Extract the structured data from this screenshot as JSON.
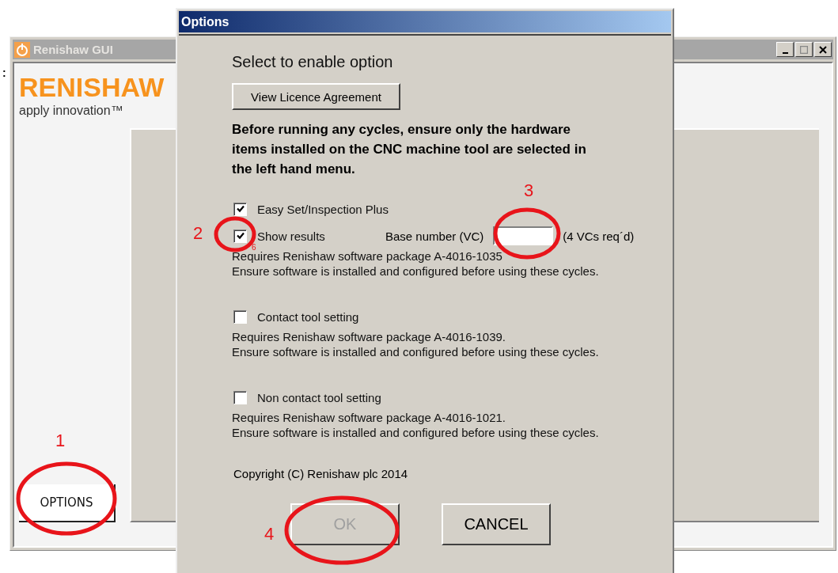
{
  "stray_mark": ":",
  "main_window": {
    "title": "Renishaw GUI",
    "logo": "RENISHAW",
    "tagline": "apply innovation™",
    "sidebar_button": "OPTIONS"
  },
  "dialog": {
    "title": "Options",
    "heading": "Select to enable option",
    "licence_button": "View Licence Agreement",
    "warning": "Before running any cycles, ensure only the hardware items installed on the CNC machine tool are selected in the left hand menu.",
    "options": [
      {
        "label": "Easy Set/Inspection Plus",
        "checked": true,
        "sub": {
          "label": "Show results",
          "checked": true,
          "field_label": "Base number (VC)",
          "note": "(4 VCs req´d)"
        },
        "requires": [
          "Requires Renishaw software package A-4016-1035",
          "Ensure software is installed and configured before using these cycles."
        ]
      },
      {
        "label": "Contact tool setting",
        "checked": false,
        "requires": [
          "Requires Renishaw software package A-4016-1039.",
          "Ensure software is installed and configured before using these cycles."
        ]
      },
      {
        "label": "Non contact tool setting",
        "checked": false,
        "requires": [
          "Requires Renishaw software package A-4016-1021.",
          "Ensure software is installed and configured before using these cycles."
        ]
      }
    ],
    "copyright": "Copyright (C) Renishaw plc 2014",
    "buttons": [
      {
        "label": "OK",
        "disabled": true
      },
      {
        "label": "CANCEL",
        "disabled": false
      }
    ]
  },
  "annotations": [
    {
      "label": "1"
    },
    {
      "label": "2"
    },
    {
      "label": "3"
    },
    {
      "label": "4"
    },
    {
      "label": "6"
    }
  ]
}
